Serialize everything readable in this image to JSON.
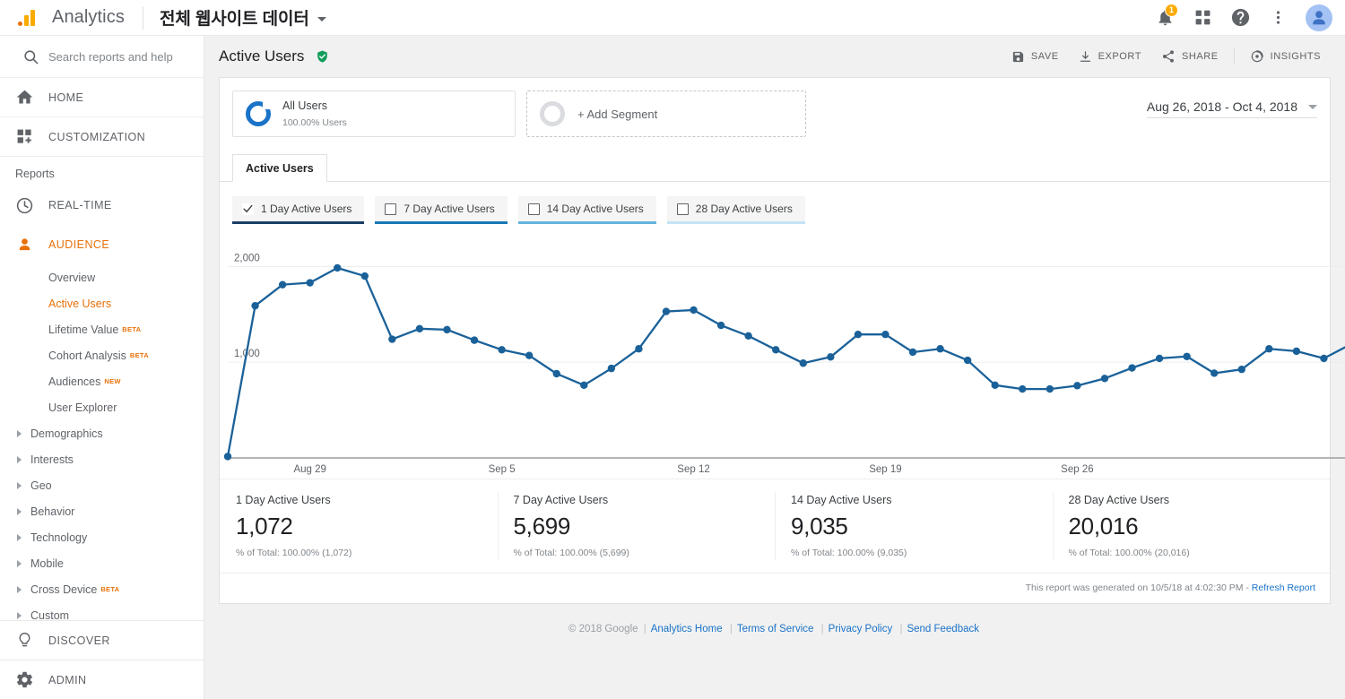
{
  "topbar": {
    "brand": "Analytics",
    "account_title": "전체 웹사이트 데이터",
    "notification_count": "1",
    "icons": [
      "bell-icon",
      "apps-grid-icon",
      "help-icon",
      "more-vert-icon",
      "avatar"
    ]
  },
  "sidebar": {
    "search_placeholder": "Search reports and help",
    "top_items": [
      {
        "label": "HOME",
        "icon": "home-icon"
      },
      {
        "label": "CUSTOMIZATION",
        "icon": "customization-icon"
      }
    ],
    "section_label": "Reports",
    "main_items": [
      {
        "label": "REAL-TIME",
        "icon": "clock-icon",
        "active": false
      },
      {
        "label": "AUDIENCE",
        "icon": "person-icon",
        "active": true
      }
    ],
    "sub_items": [
      {
        "label": "Overview",
        "badge": "",
        "expandable": false,
        "selected": false
      },
      {
        "label": "Active Users",
        "badge": "",
        "expandable": false,
        "selected": true
      },
      {
        "label": "Lifetime Value",
        "badge": "BETA",
        "expandable": false,
        "selected": false
      },
      {
        "label": "Cohort Analysis",
        "badge": "BETA",
        "expandable": false,
        "selected": false
      },
      {
        "label": "Audiences",
        "badge": "NEW",
        "expandable": false,
        "selected": false
      },
      {
        "label": "User Explorer",
        "badge": "",
        "expandable": false,
        "selected": false
      },
      {
        "label": "Demographics",
        "badge": "",
        "expandable": true,
        "selected": false
      },
      {
        "label": "Interests",
        "badge": "",
        "expandable": true,
        "selected": false
      },
      {
        "label": "Geo",
        "badge": "",
        "expandable": true,
        "selected": false
      },
      {
        "label": "Behavior",
        "badge": "",
        "expandable": true,
        "selected": false
      },
      {
        "label": "Technology",
        "badge": "",
        "expandable": true,
        "selected": false
      },
      {
        "label": "Mobile",
        "badge": "",
        "expandable": true,
        "selected": false
      },
      {
        "label": "Cross Device",
        "badge": "BETA",
        "expandable": true,
        "selected": false
      },
      {
        "label": "Custom",
        "badge": "",
        "expandable": true,
        "selected": false
      }
    ],
    "bottom_items": [
      {
        "label": "DISCOVER",
        "icon": "lightbulb-icon"
      },
      {
        "label": "ADMIN",
        "icon": "gear-icon"
      }
    ]
  },
  "header": {
    "page_title": "Active Users",
    "verified_icon": "green-shield-check-icon",
    "actions": [
      {
        "label": "SAVE",
        "icon": "save-icon"
      },
      {
        "label": "EXPORT",
        "icon": "export-icon"
      },
      {
        "label": "SHARE",
        "icon": "share-icon"
      },
      {
        "label": "INSIGHTS",
        "icon": "insights-icon"
      }
    ],
    "date_range": "Aug 26, 2018 - Oct 4, 2018"
  },
  "segments": {
    "all_users_name": "All Users",
    "all_users_sub": "100.00% Users",
    "add_segment_label": "+ Add Segment"
  },
  "tabs": [
    {
      "label": "Active Users",
      "active": true
    }
  ],
  "metric_toggles": [
    {
      "label": "1 Day Active Users",
      "checked": true,
      "color": "#1a3f66"
    },
    {
      "label": "7 Day Active Users",
      "checked": false,
      "color": "#1878b5"
    },
    {
      "label": "14 Day Active Users",
      "checked": false,
      "color": "#66b3dd"
    },
    {
      "label": "28 Day Active Users",
      "checked": false,
      "color": "#c5e3f3"
    }
  ],
  "summary": [
    {
      "name": "1 Day Active Users",
      "value": "1,072",
      "pct": "% of Total: 100.00% (1,072)"
    },
    {
      "name": "7 Day Active Users",
      "value": "5,699",
      "pct": "% of Total: 100.00% (5,699)"
    },
    {
      "name": "14 Day Active Users",
      "value": "9,035",
      "pct": "% of Total: 100.00% (9,035)"
    },
    {
      "name": "28 Day Active Users",
      "value": "20,016",
      "pct": "% of Total: 100.00% (20,016)"
    }
  ],
  "report_footer": {
    "text": "This report was generated on 10/5/18 at 4:02:30 PM - ",
    "link": "Refresh Report"
  },
  "page_footer": {
    "copyright": "© 2018 Google",
    "links": [
      "Analytics Home",
      "Terms of Service",
      "Privacy Policy",
      "Send Feedback"
    ]
  },
  "chart_data": {
    "type": "line",
    "title": "1 Day Active Users",
    "xlabel": "",
    "ylabel": "",
    "ylim": [
      0,
      2200
    ],
    "yticks": [
      1000,
      2000
    ],
    "ytick_labels": [
      "1,000",
      "2,000"
    ],
    "grid": true,
    "legend": "none",
    "series_color": "#1a6199",
    "xtick_labels": [
      "Aug 29",
      "Sep 5",
      "Sep 12",
      "Sep 19",
      "Sep 26"
    ],
    "xtick_dates": [
      "2018-08-29",
      "2018-09-05",
      "2018-09-12",
      "2018-09-19",
      "2018-09-26"
    ],
    "x": [
      "Aug 26",
      "Aug 27",
      "Aug 28",
      "Aug 29",
      "Aug 30",
      "Aug 31",
      "Sep 1",
      "Sep 2",
      "Sep 3",
      "Sep 4",
      "Sep 5",
      "Sep 6",
      "Sep 7",
      "Sep 8",
      "Sep 9",
      "Sep 10",
      "Sep 11",
      "Sep 12",
      "Sep 13",
      "Sep 14",
      "Sep 15",
      "Sep 16",
      "Sep 17",
      "Sep 18",
      "Sep 19",
      "Sep 20",
      "Sep 21",
      "Sep 22",
      "Sep 23",
      "Sep 24",
      "Sep 25",
      "Sep 26",
      "Sep 27",
      "Sep 28",
      "Sep 29",
      "Sep 30",
      "Oct 1",
      "Oct 2",
      "Oct 3",
      "Oct 4"
    ],
    "series": [
      {
        "name": "1 Day Active Users",
        "values": [
          15,
          1590,
          1810,
          1830,
          1985,
          1900,
          1240,
          1350,
          1340,
          1230,
          1130,
          1070,
          880,
          760,
          935,
          1140,
          1530,
          1545,
          1385,
          1275,
          1130,
          990,
          1055,
          1290,
          1290,
          1105,
          1140,
          1020,
          760,
          720,
          720,
          755,
          830,
          940,
          1040,
          1060,
          885,
          925,
          1140,
          1115,
          1040,
          1190
        ]
      }
    ]
  }
}
